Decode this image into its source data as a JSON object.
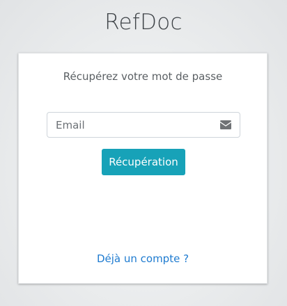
{
  "app": {
    "title": "RefDoc"
  },
  "recovery_form": {
    "subtitle": "Récupérez votre mot de passe",
    "email": {
      "placeholder": "Email",
      "value": "",
      "icon": "envelope-icon"
    },
    "submit_label": "Récupération",
    "login_link": "Déjà un compte ?"
  },
  "colors": {
    "primary_button": "#17a2b8",
    "link": "#1e7bd0"
  }
}
